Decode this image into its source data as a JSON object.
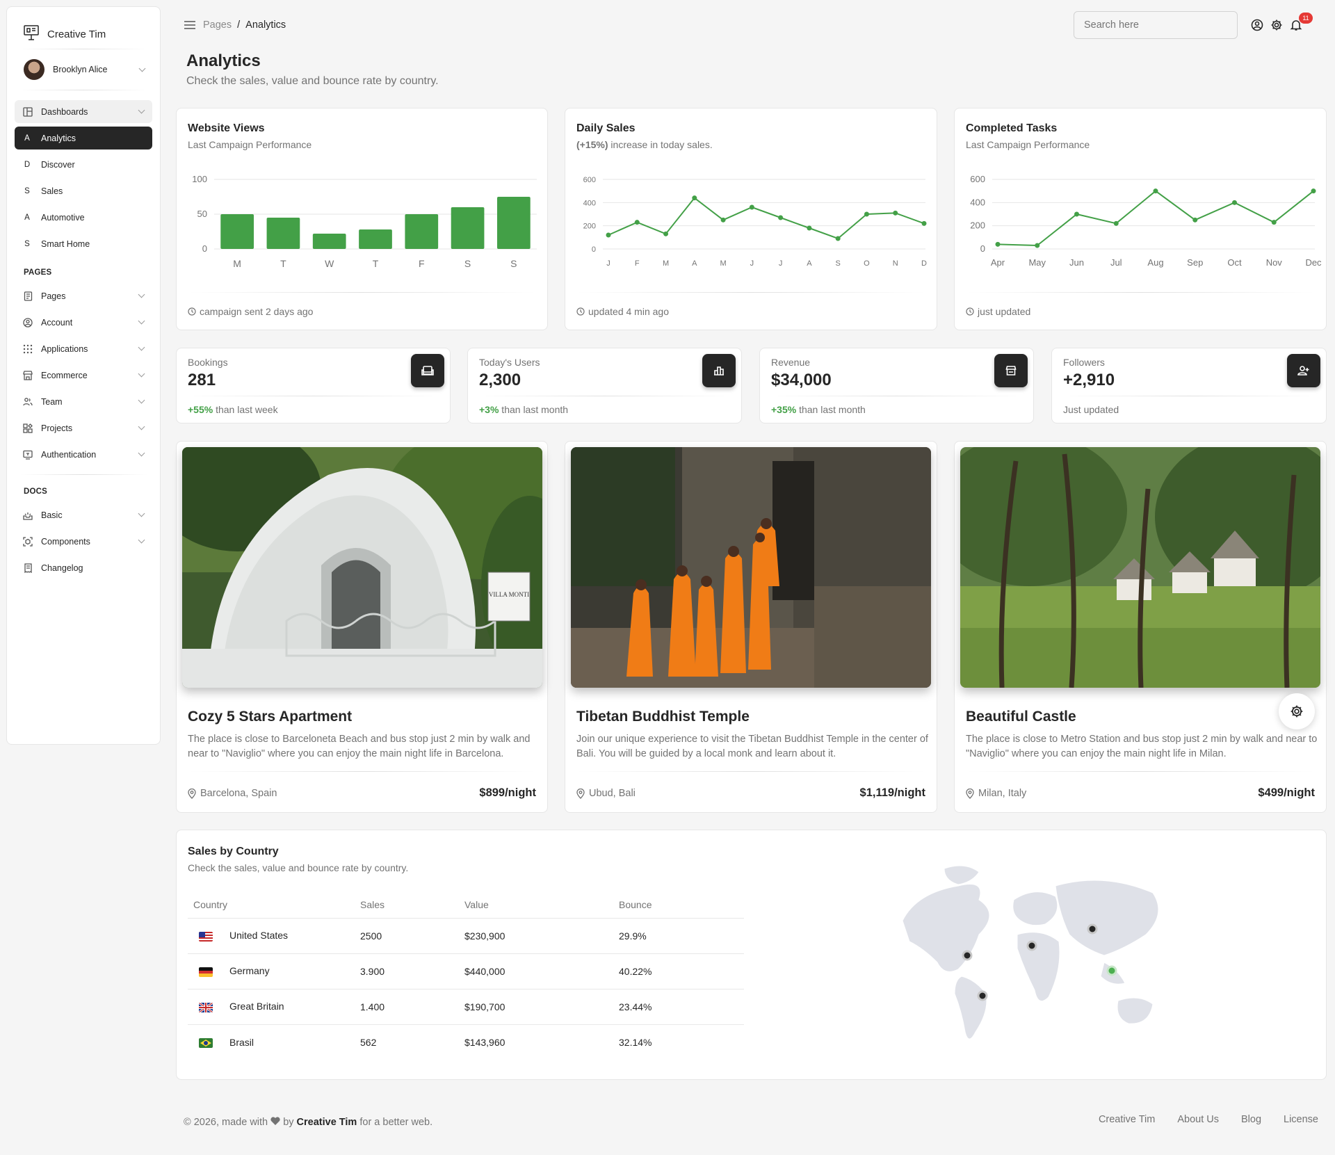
{
  "brand": {
    "name": "Creative Tim"
  },
  "user": {
    "name": "Brooklyn Alice"
  },
  "sidebar": {
    "dashboards_label": "Dashboards",
    "dashboard_items": [
      {
        "letter": "A",
        "label": "Analytics"
      },
      {
        "letter": "D",
        "label": "Discover"
      },
      {
        "letter": "S",
        "label": "Sales"
      },
      {
        "letter": "A",
        "label": "Automotive"
      },
      {
        "letter": "S",
        "label": "Smart Home"
      }
    ],
    "pages_heading": "PAGES",
    "pages_items": [
      "Pages",
      "Account",
      "Applications",
      "Ecommerce",
      "Team",
      "Projects",
      "Authentication"
    ],
    "docs_heading": "DOCS",
    "docs_items": [
      "Basic",
      "Components",
      "Changelog"
    ]
  },
  "header": {
    "breadcrumb_root": "Pages",
    "breadcrumb_current": "Analytics",
    "search_placeholder": "Search here",
    "notification_count": "11"
  },
  "page": {
    "title": "Analytics",
    "subtitle": "Check the sales, value and bounce rate by country."
  },
  "charts": {
    "website_views": {
      "title": "Website Views",
      "subtitle": "Last Campaign Performance",
      "footer": "campaign sent 2 days ago"
    },
    "daily_sales": {
      "title": "Daily Sales",
      "subtitle_bold": "(+15%)",
      "subtitle_rest": " increase in today sales.",
      "footer": "updated 4 min ago"
    },
    "completed_tasks": {
      "title": "Completed Tasks",
      "subtitle": "Last Campaign Performance",
      "footer": "just updated"
    }
  },
  "chart_data": [
    {
      "type": "bar",
      "categories": [
        "M",
        "T",
        "W",
        "T",
        "F",
        "S",
        "S"
      ],
      "values": [
        50,
        45,
        22,
        28,
        50,
        60,
        75
      ],
      "ylim": [
        0,
        100
      ],
      "yticks": [
        "100",
        "50",
        "0"
      ],
      "color": "#43a047"
    },
    {
      "type": "line",
      "categories": [
        "J",
        "F",
        "M",
        "A",
        "M",
        "J",
        "J",
        "A",
        "S",
        "O",
        "N",
        "D"
      ],
      "values": [
        120,
        230,
        130,
        440,
        250,
        360,
        270,
        180,
        90,
        300,
        310,
        220
      ],
      "ylim": [
        0,
        600
      ],
      "yticks": [
        "600",
        "400",
        "200",
        "0"
      ],
      "color": "#43a047"
    },
    {
      "type": "line",
      "categories": [
        "Apr",
        "May",
        "Jun",
        "Jul",
        "Aug",
        "Sep",
        "Oct",
        "Nov",
        "Dec"
      ],
      "values": [
        40,
        30,
        300,
        220,
        500,
        250,
        400,
        230,
        500
      ],
      "ylim": [
        0,
        600
      ],
      "yticks": [
        "600",
        "400",
        "200",
        "0"
      ],
      "color": "#43a047"
    }
  ],
  "stats": [
    {
      "label": "Bookings",
      "value": "281",
      "change": "+55%",
      "note": " than last week",
      "icon": "weekend-icon"
    },
    {
      "label": "Today's Users",
      "value": "2,300",
      "change": "+3%",
      "note": " than last month",
      "icon": "leaderboard-icon"
    },
    {
      "label": "Revenue",
      "value": "$34,000",
      "change": "+35%",
      "note": " than last month",
      "icon": "store-icon"
    },
    {
      "label": "Followers",
      "value": "+2,910",
      "change": "",
      "note": "Just updated",
      "icon": "person-add-icon"
    }
  ],
  "places": [
    {
      "title": "Cozy 5 Stars Apartment",
      "description": "The place is close to Barceloneta Beach and bus stop just 2 min by walk and near to \"Naviglio\" where you can enjoy the main night life in Barcelona.",
      "location": "Barcelona, Spain",
      "price": "$899/night",
      "sign_text": "VILLA MONTI"
    },
    {
      "title": "Tibetan Buddhist Temple",
      "description": "Join our unique experience to visit the Tibetan Buddhist Temple in the center of Bali. You will be guided by a local monk and learn about it.",
      "location": "Ubud, Bali",
      "price": "$1,119/night"
    },
    {
      "title": "Beautiful Castle",
      "description": "The place is close to Metro Station and bus stop just 2 min by walk and near to \"Naviglio\" where you can enjoy the main night life in Milan.",
      "location": "Milan, Italy",
      "price": "$499/night"
    }
  ],
  "sales_by_country": {
    "title": "Sales by Country",
    "subtitle": "Check the sales, value and bounce rate by country.",
    "columns": [
      "Country",
      "Sales",
      "Value",
      "Bounce"
    ],
    "rows": [
      {
        "country": "United States",
        "sales": "2500",
        "value": "$230,900",
        "bounce": "29.9%",
        "flag": "us-flag"
      },
      {
        "country": "Germany",
        "sales": "3.900",
        "value": "$440,000",
        "bounce": "40.22%",
        "flag": "de-flag"
      },
      {
        "country": "Great Britain",
        "sales": "1.400",
        "value": "$190,700",
        "bounce": "23.44%",
        "flag": "gb-flag"
      },
      {
        "country": "Brasil",
        "sales": "562",
        "value": "$143,960",
        "bounce": "32.14%",
        "flag": "br-flag"
      }
    ]
  },
  "footer": {
    "copy_prefix": "© 2026, made with",
    "copy_by": "by",
    "copy_brand": "Creative Tim",
    "copy_suffix": "for a better web.",
    "links": [
      "Creative Tim",
      "About Us",
      "Blog",
      "License"
    ]
  }
}
